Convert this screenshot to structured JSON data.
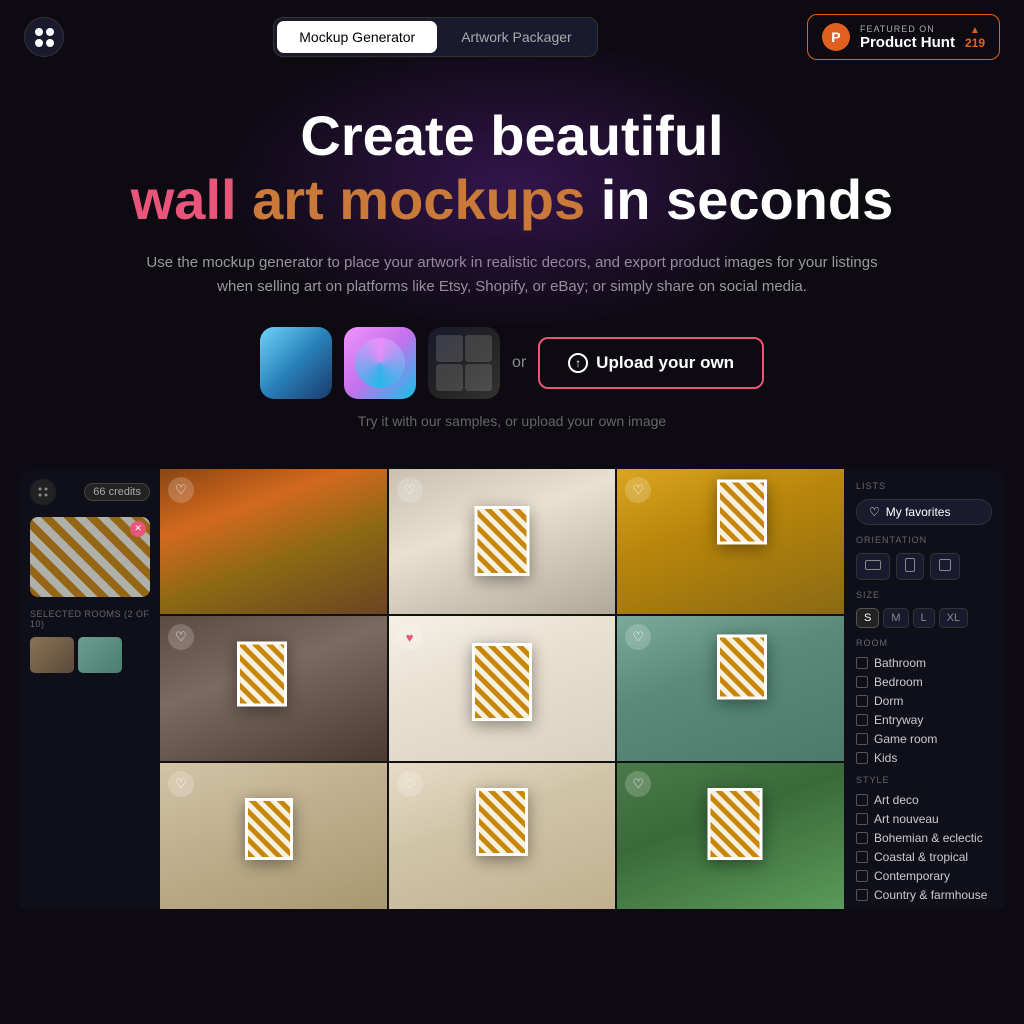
{
  "nav": {
    "tabs": [
      {
        "id": "mockup",
        "label": "Mockup Generator",
        "active": true
      },
      {
        "id": "artwork",
        "label": "Artwork Packager",
        "active": false
      }
    ]
  },
  "product_hunt": {
    "featured_label": "FEATURED ON",
    "name": "Product Hunt",
    "count": "219",
    "arrow": "▲"
  },
  "hero": {
    "line1": "Create beautiful",
    "line2_wall": "wall",
    "line2_art": "art",
    "line2_mockups": "mockups",
    "line2_in_seconds": "in seconds",
    "subtitle": "Use the mockup generator to place your artwork in realistic decors, and export product images for your listings when selling art on platforms like Etsy, Shopify, or eBay; or simply share on social media.",
    "or_text": "or",
    "upload_btn": "Upload your own",
    "hint": "Try it with our samples, or upload your own image"
  },
  "left_panel": {
    "credits": "66 credits",
    "selected_rooms_label": "SELECTED ROOMS (2 OF 10)"
  },
  "right_panel": {
    "lists_label": "LISTS",
    "favorites_label": "My favorites",
    "orientation_label": "ORIENTATION",
    "size_label": "SIZE",
    "sizes": [
      "S",
      "M",
      "L",
      "XL"
    ],
    "room_label": "ROOM",
    "rooms": [
      "Bathroom",
      "Bedroom",
      "Dorm",
      "Entryway",
      "Game room",
      "Kids"
    ],
    "style_label": "STYLE",
    "styles": [
      "Art deco",
      "Art nouveau",
      "Bohemian & eclectic",
      "Coastal & tropical",
      "Contemporary",
      "Country & farmhouse"
    ]
  },
  "grid_rooms": [
    {
      "id": 1,
      "hearted": false,
      "style": "room-living-orange"
    },
    {
      "id": 2,
      "hearted": false,
      "style": "room-living-white"
    },
    {
      "id": 3,
      "hearted": false,
      "style": "room-living-yellow"
    },
    {
      "id": 4,
      "hearted": false,
      "style": "room-brick"
    },
    {
      "id": 5,
      "hearted": true,
      "style": "room-white-boho"
    },
    {
      "id": 6,
      "hearted": false,
      "style": "room-bedroom"
    },
    {
      "id": 7,
      "hearted": false,
      "style": "room-arch"
    },
    {
      "id": 8,
      "hearted": false,
      "style": "room-boho2"
    },
    {
      "id": 9,
      "hearted": false,
      "style": "room-tropical"
    }
  ]
}
